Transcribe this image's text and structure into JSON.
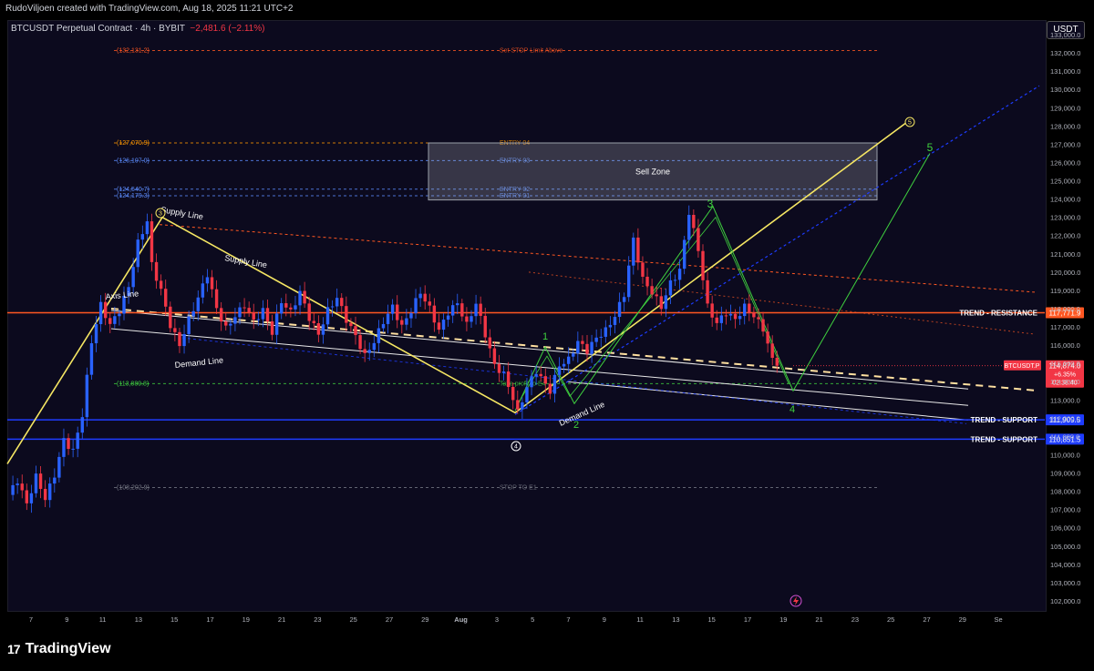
{
  "header": {
    "credit": "RudoViljoen created with TradingView.com, Aug 18, 2025 11:21 UTC+2",
    "symbol": "BTCUSDT Perpetual Contract · 4h · BYBIT",
    "change": "−2,481.6 (−2.11%)",
    "currency_button": "USDT"
  },
  "footer": {
    "brand": "TradingView",
    "logo": "17"
  },
  "colors": {
    "up": "#2962ff",
    "down": "#f23645",
    "supply": "#f5e663",
    "resistance": "#ff5722",
    "support": "#1e3cff",
    "elliott": "#3fd13f"
  },
  "chart_data": {
    "type": "candlestick",
    "timeframe": "4h",
    "ylim": [
      101500,
      133800
    ],
    "y_ticks": [
      102000,
      103000,
      104000,
      105000,
      106000,
      107000,
      108000,
      109000,
      110000,
      111000,
      112000,
      113000,
      114000,
      115000,
      116000,
      117000,
      118000,
      119000,
      120000,
      121000,
      122000,
      123000,
      124000,
      125000,
      126000,
      127000,
      128000,
      129000,
      130000,
      131000,
      132000,
      133000
    ],
    "x_ticks": [
      "7",
      "9",
      "11",
      "13",
      "15",
      "17",
      "19",
      "21",
      "23",
      "25",
      "27",
      "29",
      "Aug",
      "3",
      "5",
      "7",
      "9",
      "11",
      "13",
      "15",
      "17",
      "19",
      "21",
      "23",
      "25",
      "27",
      "29",
      "Se"
    ],
    "price_path": [
      [
        0,
        107800
      ],
      [
        2,
        108600
      ],
      [
        4,
        107300
      ],
      [
        6,
        108800
      ],
      [
        8,
        107600
      ],
      [
        10,
        108900
      ],
      [
        12,
        110800
      ],
      [
        14,
        110200
      ],
      [
        16,
        112200
      ],
      [
        18,
        116200
      ],
      [
        20,
        118200
      ],
      [
        22,
        117100
      ],
      [
        24,
        117900
      ],
      [
        26,
        119200
      ],
      [
        28,
        121600
      ],
      [
        30,
        122800
      ],
      [
        31,
        120400
      ],
      [
        33,
        119000
      ],
      [
        35,
        117100
      ],
      [
        37,
        116000
      ],
      [
        39,
        117400
      ],
      [
        41,
        118600
      ],
      [
        43,
        119900
      ],
      [
        45,
        118000
      ],
      [
        47,
        116900
      ],
      [
        49,
        117600
      ],
      [
        51,
        118200
      ],
      [
        53,
        117300
      ],
      [
        55,
        117900
      ],
      [
        57,
        116700
      ],
      [
        59,
        118400
      ],
      [
        61,
        117800
      ],
      [
        63,
        118900
      ],
      [
        65,
        117500
      ],
      [
        67,
        116600
      ],
      [
        69,
        117900
      ],
      [
        71,
        118600
      ],
      [
        73,
        117400
      ],
      [
        75,
        116500
      ],
      [
        77,
        115400
      ],
      [
        79,
        116200
      ],
      [
        81,
        117300
      ],
      [
        83,
        118100
      ],
      [
        85,
        117000
      ],
      [
        87,
        117900
      ],
      [
        89,
        118900
      ],
      [
        91,
        118000
      ],
      [
        93,
        116800
      ],
      [
        95,
        117800
      ],
      [
        97,
        118300
      ],
      [
        99,
        117100
      ],
      [
        101,
        118300
      ],
      [
        103,
        116600
      ],
      [
        105,
        114900
      ],
      [
        107,
        114400
      ],
      [
        109,
        113100
      ],
      [
        110,
        112300
      ],
      [
        112,
        113700
      ],
      [
        114,
        114600
      ],
      [
        115,
        114200
      ],
      [
        117,
        113500
      ],
      [
        119,
        114900
      ],
      [
        121,
        115200
      ],
      [
        123,
        116200
      ],
      [
        125,
        115700
      ],
      [
        127,
        116400
      ],
      [
        129,
        116800
      ],
      [
        131,
        117600
      ],
      [
        133,
        118800
      ],
      [
        135,
        121800
      ],
      [
        137,
        119600
      ],
      [
        139,
        118900
      ],
      [
        141,
        118100
      ],
      [
        143,
        119400
      ],
      [
        145,
        120100
      ],
      [
        147,
        123300
      ],
      [
        149,
        121200
      ],
      [
        151,
        118100
      ],
      [
        153,
        117200
      ],
      [
        155,
        117800
      ],
      [
        157,
        117400
      ],
      [
        159,
        118100
      ],
      [
        161,
        117600
      ],
      [
        163,
        116900
      ],
      [
        165,
        115200
      ],
      [
        166,
        114874
      ]
    ],
    "horizontal_levels": [
      {
        "price": 132131.2,
        "label": "(132,131.2)",
        "note": "Set STOP Limit Above"
      },
      {
        "price": 127070.9,
        "label": "(127,070.9)",
        "note": "ENTRY 04"
      },
      {
        "price": 126107.0,
        "label": "(126,107.0)",
        "note": "ENTRY 03"
      },
      {
        "price": 124540.7,
        "label": "(124,540.7)",
        "note": "ENTRY 02"
      },
      {
        "price": 124179.3,
        "label": "(124,179.3)",
        "note": "ENTRY 01"
      },
      {
        "price": 113889.8,
        "label": "(113,889.8)",
        "note": "Take profit to E4"
      },
      {
        "price": 108202.9,
        "label": "(108,202.9)",
        "note": "STOP TO E1"
      }
    ],
    "sell_zone": {
      "label": "Sell Zone",
      "top": 127070.9,
      "bottom": 123950
    },
    "trend_lines": [
      {
        "name": "TREND - RESISTANCE",
        "price": 117771.9,
        "tag": "117,771.9"
      },
      {
        "name": "TREND - SUPPORT",
        "price": 111909.5,
        "tag": "111,909.5"
      },
      {
        "name": "TREND - SUPPORT",
        "price": 110851.5,
        "tag": "110,851.5"
      }
    ],
    "current_price": {
      "symbol": "BTCUSDT.P",
      "price": 114874.0,
      "tag": "114,874.0",
      "change": "+6.35%",
      "countdown": "02:38:40"
    },
    "annotations": [
      "Supply Line",
      "Supply Line",
      "Axis Line",
      "Demand Line",
      "Demand Line"
    ],
    "elliott_waves": [
      "1",
      "2",
      "3",
      "4",
      "5"
    ],
    "circled_waves": [
      "3",
      "4",
      "5"
    ]
  }
}
